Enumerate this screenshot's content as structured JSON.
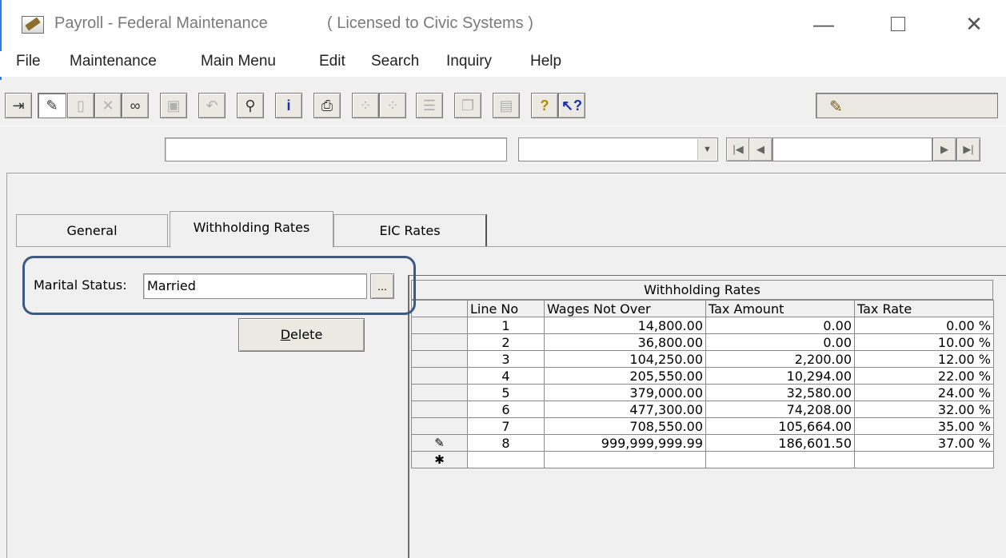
{
  "window": {
    "title": "Payroll - Federal Maintenance",
    "license": "( Licensed to Civic Systems )",
    "minimize": "—",
    "close": "✕"
  },
  "menu": [
    "File",
    "Maintenance",
    "Main Menu",
    "Edit",
    "Search",
    "Inquiry",
    "Help"
  ],
  "toolbar": {
    "icons": [
      "exit-icon",
      "edit-pencil-icon",
      "new-record-icon",
      "delete-x-icon",
      "view-glasses-icon",
      "save-disk-icon",
      "undo-icon",
      "find-binoculars-icon",
      "info-icon",
      "print-icon",
      "prev-group-icon",
      "next-group-icon",
      "list-icon",
      "copy-icon",
      "notes-icon",
      "help-icon",
      "context-help-icon"
    ],
    "mode_icon": "pencil-icon"
  },
  "navigator": {
    "search_value": "",
    "combo_value": ""
  },
  "tabs": [
    "General",
    "Withholding Rates",
    "EIC Rates"
  ],
  "marital": {
    "label": "Marital Status:",
    "value": "Married",
    "browse": "..."
  },
  "delete_button": "Delete",
  "grid": {
    "title": "Withholding Rates",
    "columns": [
      "Line No",
      "Wages Not Over",
      "Tax Amount",
      "Tax Rate"
    ],
    "rows": [
      {
        "marker": "",
        "line": "1",
        "wages": "14,800.00",
        "tax": "0.00",
        "rate": "0.00 %"
      },
      {
        "marker": "",
        "line": "2",
        "wages": "36,800.00",
        "tax": "0.00",
        "rate": "10.00 %"
      },
      {
        "marker": "",
        "line": "3",
        "wages": "104,250.00",
        "tax": "2,200.00",
        "rate": "12.00 %"
      },
      {
        "marker": "",
        "line": "4",
        "wages": "205,550.00",
        "tax": "10,294.00",
        "rate": "22.00 %"
      },
      {
        "marker": "",
        "line": "5",
        "wages": "379,000.00",
        "tax": "32,580.00",
        "rate": "24.00 %"
      },
      {
        "marker": "",
        "line": "6",
        "wages": "477,300.00",
        "tax": "74,208.00",
        "rate": "32.00 %"
      },
      {
        "marker": "",
        "line": "7",
        "wages": "708,550.00",
        "tax": "105,664.00",
        "rate": "35.00 %"
      },
      {
        "marker": "✎",
        "line": "8",
        "wages": "999,999,999.99",
        "tax": "186,601.50",
        "rate": "37.00 %"
      },
      {
        "marker": "✱",
        "line": "",
        "wages": "",
        "tax": "",
        "rate": ""
      }
    ]
  }
}
